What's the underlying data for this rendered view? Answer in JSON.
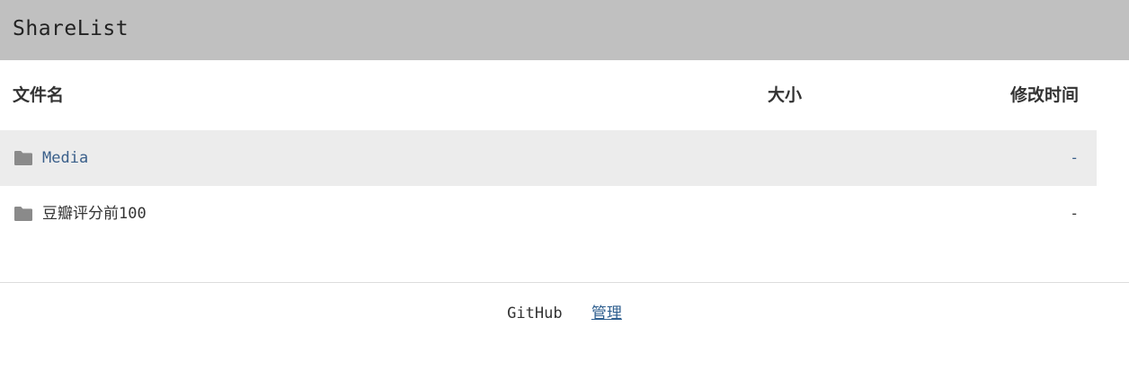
{
  "header": {
    "title": "ShareList"
  },
  "table": {
    "columns": {
      "name": "文件名",
      "size": "大小",
      "modified": "修改时间"
    },
    "rows": [
      {
        "icon": "folder-icon",
        "name": "Media",
        "size": "",
        "modified": "-"
      },
      {
        "icon": "folder-icon",
        "name": "豆瓣评分前100",
        "size": "",
        "modified": "-"
      }
    ]
  },
  "footer": {
    "links": [
      {
        "label": "GitHub"
      },
      {
        "label": "管理"
      }
    ]
  },
  "colors": {
    "header_bg": "#c0c0c0",
    "row_hover_bg": "#ececec",
    "link_accent": "#3a5f8a",
    "folder_icon": "#8a8a8a"
  }
}
